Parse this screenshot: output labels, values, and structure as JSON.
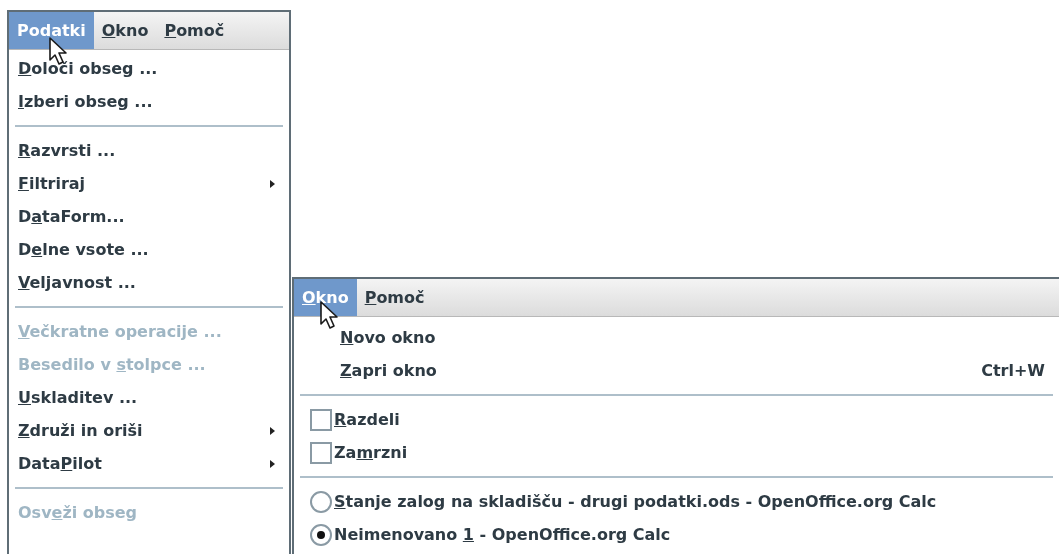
{
  "menus": [
    {
      "menubar": [
        {
          "label": {
            "pre": "Podatki"
          },
          "selected": true
        },
        {
          "label": {
            "key": "O",
            "post": "kno"
          },
          "selected": false
        },
        {
          "label": {
            "key": "P",
            "post": "omoč"
          },
          "selected": false
        }
      ],
      "items": [
        {
          "kind": "item",
          "label": {
            "key": "D",
            "post": "oloči obseg ..."
          },
          "disabled": false,
          "submenu": false
        },
        {
          "kind": "item",
          "label": {
            "key": "I",
            "post": "zberi obseg ..."
          },
          "disabled": false,
          "submenu": false
        },
        {
          "kind": "separator"
        },
        {
          "kind": "item",
          "label": {
            "key": "R",
            "post": "azvrsti ..."
          },
          "disabled": false,
          "submenu": false
        },
        {
          "kind": "item",
          "label": {
            "key": "F",
            "post": "iltriraj"
          },
          "disabled": false,
          "submenu": true
        },
        {
          "kind": "item",
          "label": {
            "pre": "D",
            "key": "a",
            "post": "taForm..."
          },
          "disabled": false,
          "submenu": false
        },
        {
          "kind": "item",
          "label": {
            "pre": "D",
            "key": "e",
            "post": "lne vsote ..."
          },
          "disabled": false,
          "submenu": false
        },
        {
          "kind": "item",
          "label": {
            "key": "V",
            "post": "eljavnost ..."
          },
          "disabled": false,
          "submenu": false
        },
        {
          "kind": "separator"
        },
        {
          "kind": "item",
          "label": {
            "key": "V",
            "post": "ečkratne operacije ..."
          },
          "disabled": true,
          "submenu": false
        },
        {
          "kind": "item",
          "label": {
            "pre": "Besedilo v ",
            "key": "s",
            "post": "tolpce ..."
          },
          "disabled": true,
          "submenu": false
        },
        {
          "kind": "item",
          "label": {
            "key": "U",
            "post": "skladitev ..."
          },
          "disabled": false,
          "submenu": false
        },
        {
          "kind": "item",
          "label": {
            "key": "Z",
            "post": "druži in oriši"
          },
          "disabled": false,
          "submenu": true
        },
        {
          "kind": "item",
          "label": {
            "pre": "Data",
            "key": "P",
            "post": "ilot"
          },
          "disabled": false,
          "submenu": true
        },
        {
          "kind": "separator"
        },
        {
          "kind": "item",
          "label": {
            "pre": "Osv",
            "key": "e",
            "post": "ži obseg"
          },
          "disabled": true,
          "submenu": false
        }
      ]
    },
    {
      "menubar": [
        {
          "label": {
            "key": "O",
            "post": "kno"
          },
          "selected": true
        },
        {
          "label": {
            "key": "P",
            "post": "omoč"
          },
          "selected": false
        }
      ],
      "items": [
        {
          "kind": "item",
          "label": {
            "key": "N",
            "post": "ovo okno"
          },
          "disabled": false,
          "submenu": false
        },
        {
          "kind": "item",
          "label": {
            "key": "Z",
            "post": "apri okno"
          },
          "shortcut": "Ctrl+W",
          "disabled": false,
          "submenu": false
        },
        {
          "kind": "separator"
        },
        {
          "kind": "checkbox",
          "label": {
            "key": "R",
            "post": "azdeli"
          },
          "checked": false
        },
        {
          "kind": "checkbox",
          "label": {
            "pre": "Za",
            "key": "m",
            "post": "rzni"
          },
          "checked": false
        },
        {
          "kind": "separator"
        },
        {
          "kind": "radio",
          "label": {
            "key": "S",
            "post": "tanje zalog na skladišču - drugi podatki.ods - OpenOffice.org Calc"
          },
          "selected": false
        },
        {
          "kind": "radio",
          "label": {
            "pre": "Neimenovano ",
            "key": "1",
            "post": " - OpenOffice.org Calc"
          },
          "selected": true
        }
      ]
    }
  ]
}
